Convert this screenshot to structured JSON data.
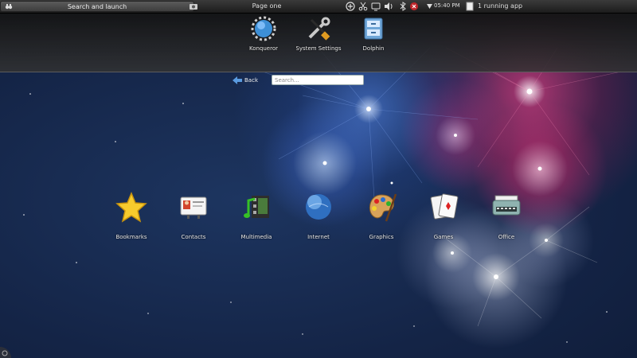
{
  "top_panel": {
    "search_launch_label": "Search and launch",
    "page_label": "Page one",
    "clock": "05:40 PM",
    "running_apps": "1 running app",
    "tray_icons": [
      "monitor-icon",
      "network-icon",
      "scissors-icon",
      "sync-icon",
      "volume-icon",
      "bluetooth-icon",
      "notification-icon"
    ]
  },
  "favorites": [
    {
      "label": "Konqueror",
      "icon": "konqueror-globe-icon"
    },
    {
      "label": "System Settings",
      "icon": "tools-icon"
    },
    {
      "label": "Dolphin",
      "icon": "file-cabinet-icon"
    }
  ],
  "navigation": {
    "back_label": "Back",
    "search_placeholder": "Search..."
  },
  "categories": [
    {
      "label": "Bookmarks",
      "icon": "star-icon"
    },
    {
      "label": "Contacts",
      "icon": "contact-card-icon"
    },
    {
      "label": "Multimedia",
      "icon": "multimedia-icon"
    },
    {
      "label": "Internet",
      "icon": "globe-icon"
    },
    {
      "label": "Graphics",
      "icon": "palette-icon"
    },
    {
      "label": "Games",
      "icon": "playing-cards-icon"
    },
    {
      "label": "Office",
      "icon": "typewriter-icon"
    }
  ],
  "colors": {
    "panel": "#2a2a2a",
    "wallpaper": "#16284a",
    "firework_blue": "#5080e6",
    "firework_pink": "#e23c82"
  }
}
